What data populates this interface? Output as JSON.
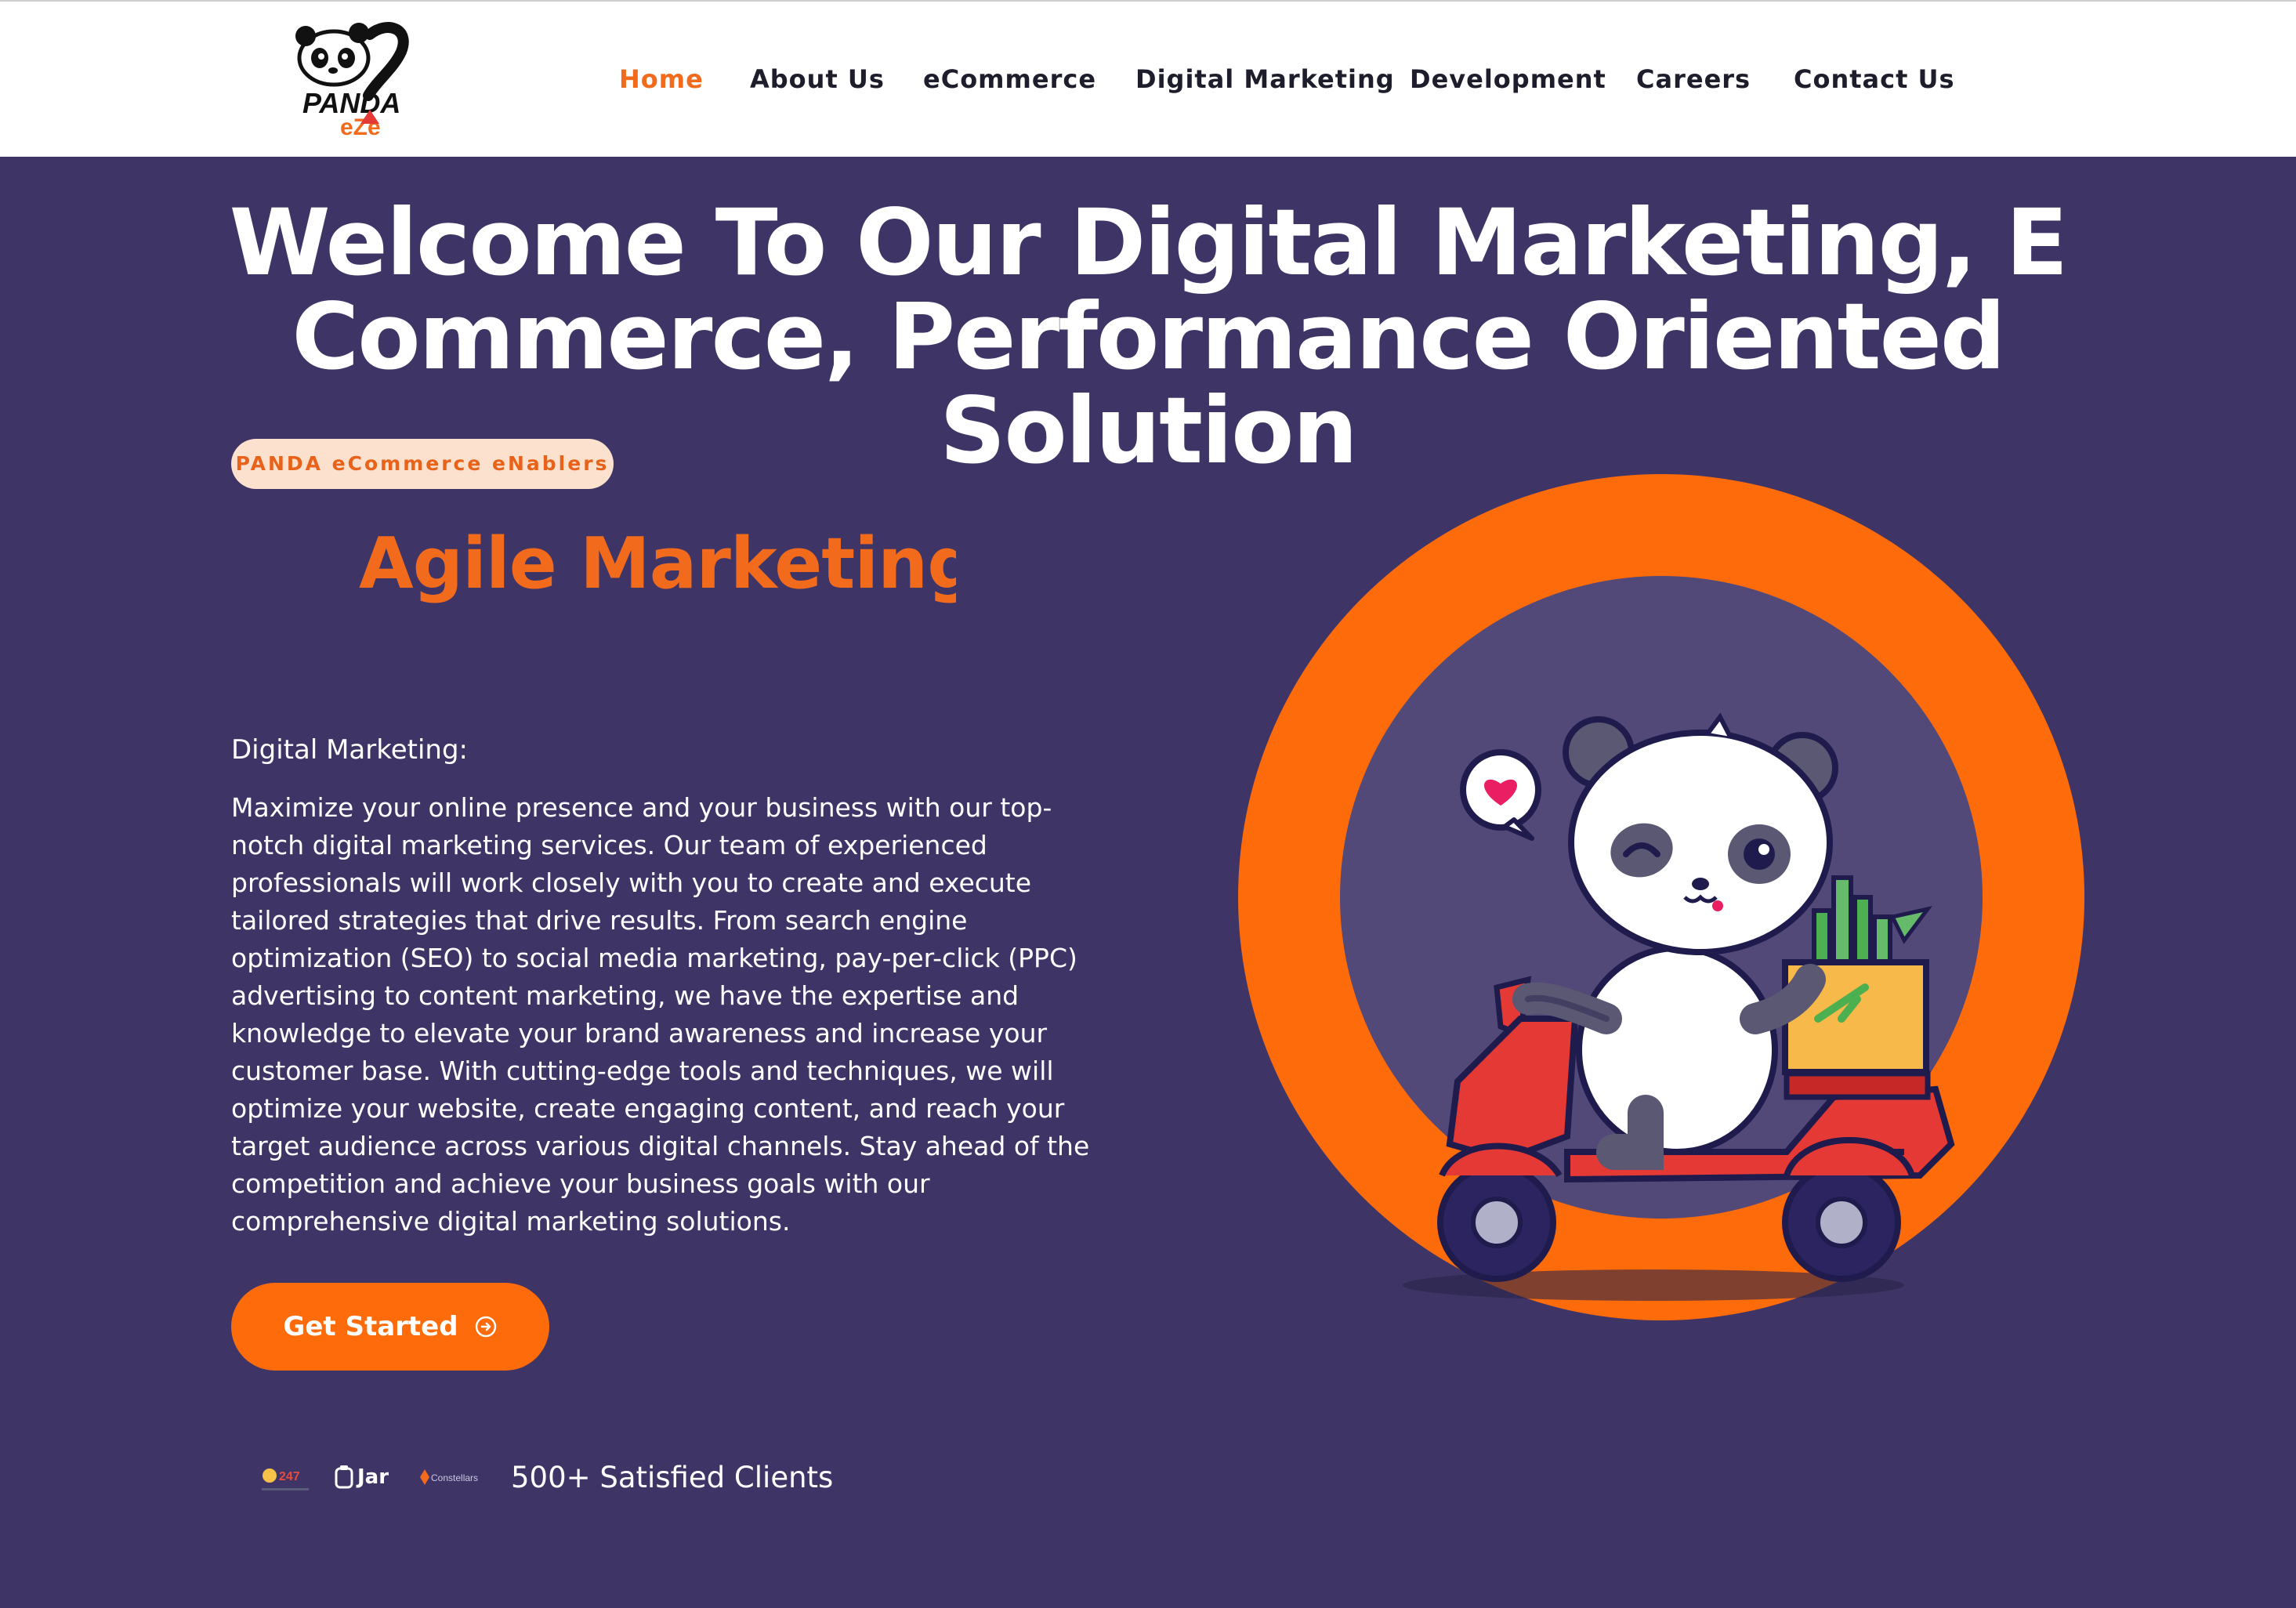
{
  "header": {
    "logo_text": "PANDA",
    "nav": [
      "Home",
      "About Us",
      "eCommerce",
      "Digital Marketing",
      "Development",
      "Careers",
      "Contact Us"
    ],
    "active_nav": "Home"
  },
  "hero": {
    "title_line1": "Welcome To Our Digital Marketing, E",
    "title_line2": "Commerce, Performance Oriented Solution",
    "badge": "PANDA eCommerce eNablers",
    "rotating_word": "Agile Marketing",
    "section_label": "Digital Marketing:",
    "description": "Maximize your online presence and your business with our top-notch digital marketing services. Our team of experienced professionals will work closely with you to create and execute tailored strategies that drive results. From search engine optimization (SEO) to social media marketing, pay-per-click (PPC) advertising to content marketing, we have the expertise and knowledge to elevate your brand awareness and increase your customer base. With cutting-edge tools and techniques, we will optimize your website, create engaging content, and reach your target audience across various digital channels. Stay ahead of the competition and achieve your business goals with our comprehensive digital marketing solutions.",
    "cta_label": "Get Started",
    "cta_icon": "arrow-circle-right-icon"
  },
  "clients": {
    "logos": [
      "247",
      "Jar",
      "Constellars"
    ],
    "summary": "500+ Satisfied Clients"
  },
  "colors": {
    "background": "#3e3566",
    "accent": "#fe6b0b",
    "badge_bg": "#fde1cf",
    "circle_inner": "#524978"
  }
}
